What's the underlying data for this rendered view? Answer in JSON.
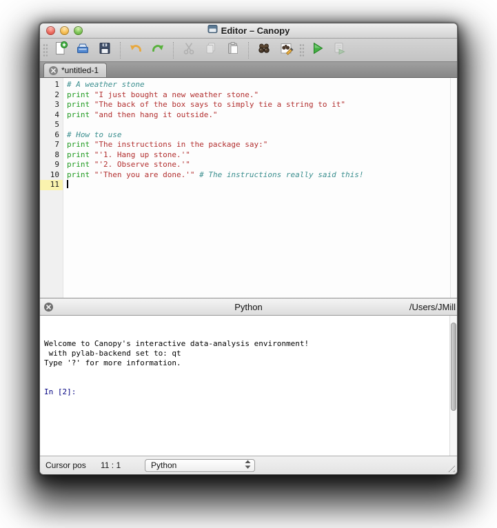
{
  "window": {
    "title": "Editor – Canopy"
  },
  "toolbar": {
    "buttons": [
      {
        "name": "new-file",
        "enabled": true
      },
      {
        "name": "open-file",
        "enabled": true
      },
      {
        "name": "save-file",
        "enabled": true
      },
      {
        "name": "undo",
        "enabled": true
      },
      {
        "name": "redo",
        "enabled": true
      },
      {
        "name": "cut",
        "enabled": false
      },
      {
        "name": "copy",
        "enabled": false
      },
      {
        "name": "paste",
        "enabled": true
      },
      {
        "name": "find",
        "enabled": true
      },
      {
        "name": "find-replace",
        "enabled": true
      },
      {
        "name": "run",
        "enabled": true
      },
      {
        "name": "run-selection",
        "enabled": false
      }
    ]
  },
  "tab": {
    "label": "*untitled-1"
  },
  "editor": {
    "lines": [
      {
        "n": "1",
        "tokens": [
          {
            "type": "comment",
            "text": "# A weather stone"
          }
        ]
      },
      {
        "n": "2",
        "tokens": [
          {
            "type": "keyword",
            "text": "print"
          },
          {
            "type": "plain",
            "text": " "
          },
          {
            "type": "string",
            "text": "\"I just bought a new weather stone.\""
          }
        ]
      },
      {
        "n": "3",
        "tokens": [
          {
            "type": "keyword",
            "text": "print"
          },
          {
            "type": "plain",
            "text": " "
          },
          {
            "type": "string",
            "text": "\"The back of the box says to simply tie a string to it\""
          }
        ]
      },
      {
        "n": "4",
        "tokens": [
          {
            "type": "keyword",
            "text": "print"
          },
          {
            "type": "plain",
            "text": " "
          },
          {
            "type": "string",
            "text": "\"and then hang it outside.\""
          }
        ]
      },
      {
        "n": "5",
        "tokens": []
      },
      {
        "n": "6",
        "tokens": [
          {
            "type": "comment",
            "text": "# How to use"
          }
        ]
      },
      {
        "n": "7",
        "tokens": [
          {
            "type": "keyword",
            "text": "print"
          },
          {
            "type": "plain",
            "text": " "
          },
          {
            "type": "string",
            "text": "\"The instructions in the package say:\""
          }
        ]
      },
      {
        "n": "8",
        "tokens": [
          {
            "type": "keyword",
            "text": "print"
          },
          {
            "type": "plain",
            "text": " "
          },
          {
            "type": "string",
            "text": "\"'1. Hang up stone.'\""
          }
        ]
      },
      {
        "n": "9",
        "tokens": [
          {
            "type": "keyword",
            "text": "print"
          },
          {
            "type": "plain",
            "text": " "
          },
          {
            "type": "string",
            "text": "\"'2. Observe stone.'\""
          }
        ]
      },
      {
        "n": "10",
        "tokens": [
          {
            "type": "keyword",
            "text": "print"
          },
          {
            "type": "plain",
            "text": " "
          },
          {
            "type": "string",
            "text": "\"'Then you are done.'\""
          },
          {
            "type": "plain",
            "text": " "
          },
          {
            "type": "comment",
            "text": "# The instructions really said this!"
          }
        ]
      },
      {
        "n": "11",
        "tokens": [],
        "current": true,
        "cursor": true
      }
    ]
  },
  "console_panel": {
    "title": "Python",
    "path": "/Users/JMill",
    "lines": [
      {
        "text": "Welcome to Canopy's interactive data-analysis environment!"
      },
      {
        "text": " with pylab-backend set to: qt"
      },
      {
        "text": "Type '?' for more information."
      },
      {
        "text": ""
      },
      {
        "text": ""
      },
      {
        "text": "In [2]:",
        "type": "prompt"
      }
    ]
  },
  "statusbar": {
    "cursor_label": "Cursor pos",
    "cursor_value": "11 : 1",
    "language": "Python"
  },
  "colors": {
    "syntax_keyword": "#1f9a1f",
    "syntax_string": "#b22f2f",
    "syntax_comment": "#3a8e8e",
    "console_prompt": "#000080",
    "current_line_gutter": "#faf3ae",
    "run_button_green": "#3fae3f"
  }
}
